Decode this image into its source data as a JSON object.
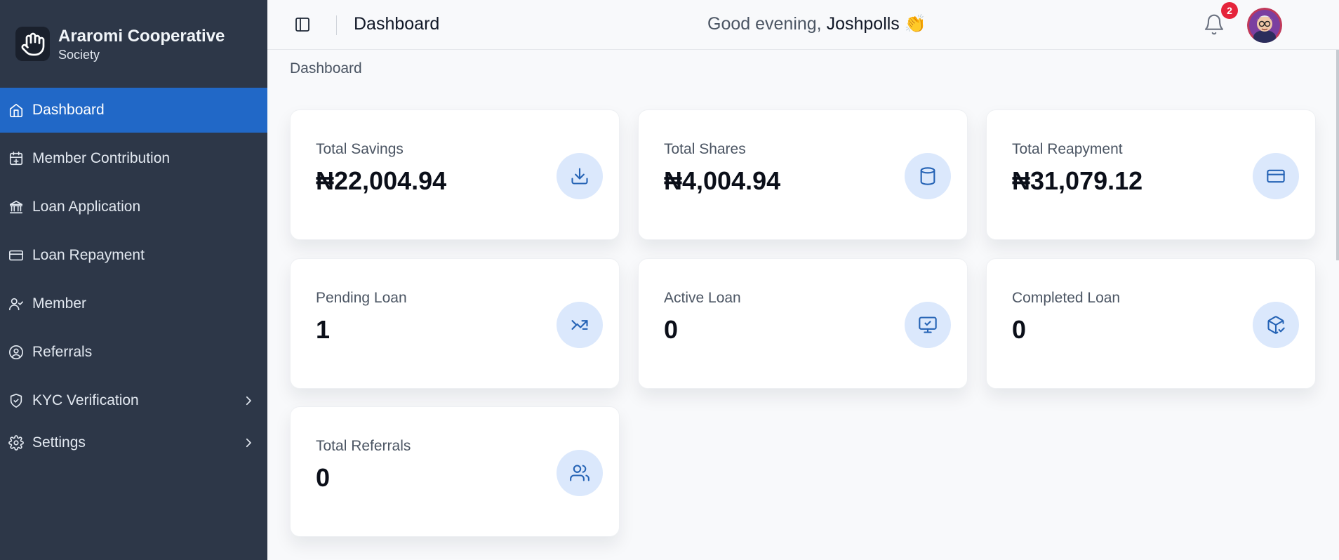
{
  "brand": {
    "name": "Araromi Cooperative",
    "sub": "Society"
  },
  "sidebar": {
    "items": [
      {
        "label": "Dashboard",
        "icon": "home-icon",
        "active": true
      },
      {
        "label": "Member Contribution",
        "icon": "calendar-plus-icon"
      },
      {
        "label": "Loan Application",
        "icon": "bank-icon"
      },
      {
        "label": "Loan Repayment",
        "icon": "credit-card-icon"
      },
      {
        "label": "Member",
        "icon": "user-check-icon"
      },
      {
        "label": "Referrals",
        "icon": "user-circle-icon"
      },
      {
        "label": "KYC Verification",
        "icon": "shield-check-icon",
        "has_submenu": true
      },
      {
        "label": "Settings",
        "icon": "gear-icon",
        "has_submenu": true
      }
    ]
  },
  "header": {
    "title": "Dashboard",
    "greeting": "Good evening,",
    "user_name": "Joshpolls",
    "emoji": "👏",
    "notification_count": "2"
  },
  "breadcrumb": "Dashboard",
  "stats": [
    {
      "label": "Total Savings",
      "value": "₦22,004.94",
      "icon": "download-icon"
    },
    {
      "label": "Total Shares",
      "value": "₦4,004.94",
      "icon": "database-icon"
    },
    {
      "label": "Total Reapyment",
      "value": "₦31,079.12",
      "icon": "credit-card-icon"
    },
    {
      "label": "Pending Loan",
      "value": "1",
      "icon": "trending-icon"
    },
    {
      "label": "Active Loan",
      "value": "0",
      "icon": "monitor-check-icon"
    },
    {
      "label": "Completed Loan",
      "value": "0",
      "icon": "package-check-icon"
    },
    {
      "label": "Total Referrals",
      "value": "0",
      "icon": "users-icon"
    }
  ],
  "colors": {
    "sidebar_bg": "#2d3748",
    "active_bg": "#2168c7",
    "icon_circle": "#dbe8fc",
    "icon_stroke": "#2563b5",
    "badge": "#e5243b"
  }
}
